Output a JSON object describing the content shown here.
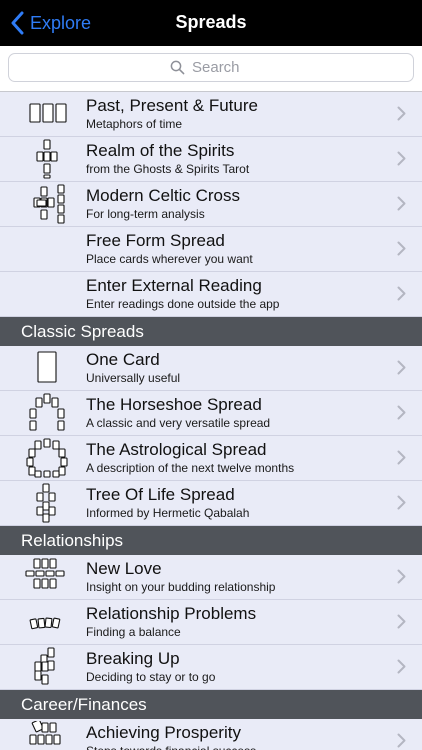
{
  "nav": {
    "back_label": "Explore",
    "title": "Spreads"
  },
  "search": {
    "placeholder": "Search"
  },
  "groups": [
    {
      "header": "",
      "items": [
        {
          "id": "ppf",
          "title": "Past, Present & Future",
          "subtitle": "Metaphors of time",
          "icon": "three-cards-icon"
        },
        {
          "id": "realm",
          "title": "Realm of the Spirits",
          "subtitle": "from the Ghosts & Spirits Tarot",
          "icon": "spirits-cross-icon"
        },
        {
          "id": "celtic",
          "title": "Modern Celtic Cross",
          "subtitle": "For long-term analysis",
          "icon": "celtic-cross-icon"
        },
        {
          "id": "freeform",
          "title": "Free Form Spread",
          "subtitle": "Place cards wherever you want",
          "icon": ""
        },
        {
          "id": "external",
          "title": "Enter External Reading",
          "subtitle": "Enter readings done outside the app",
          "icon": ""
        }
      ]
    },
    {
      "header": "Classic Spreads",
      "items": [
        {
          "id": "onecard",
          "title": "One Card",
          "subtitle": "Universally useful",
          "icon": "single-card-icon"
        },
        {
          "id": "horseshoe",
          "title": "The Horseshoe Spread",
          "subtitle": "A classic and very versatile spread",
          "icon": "horseshoe-icon"
        },
        {
          "id": "astro",
          "title": "The Astrological Spread",
          "subtitle": "A description of the next twelve months",
          "icon": "astrological-circle-icon"
        },
        {
          "id": "tol",
          "title": "Tree Of Life Spread",
          "subtitle": "Informed by Hermetic Qabalah",
          "icon": "tree-of-life-icon"
        }
      ]
    },
    {
      "header": "Relationships",
      "items": [
        {
          "id": "newlove",
          "title": "New Love",
          "subtitle": "Insight on your budding relationship",
          "icon": "new-love-icon"
        },
        {
          "id": "relprob",
          "title": "Relationship Problems",
          "subtitle": "Finding a balance",
          "icon": "relationship-problems-icon"
        },
        {
          "id": "breakup",
          "title": "Breaking Up",
          "subtitle": "Deciding to stay or to go",
          "icon": "breaking-up-icon"
        }
      ]
    },
    {
      "header": "Career/Finances",
      "items": [
        {
          "id": "prosperity",
          "title": "Achieving Prosperity",
          "subtitle": "Steps towards financial success",
          "icon": "prosperity-icon"
        }
      ]
    }
  ],
  "colors": {
    "nav_bg": "#000000",
    "accent": "#2f7cf6",
    "row_bg": "#e9ebf7",
    "section_bg": "#50545a"
  }
}
